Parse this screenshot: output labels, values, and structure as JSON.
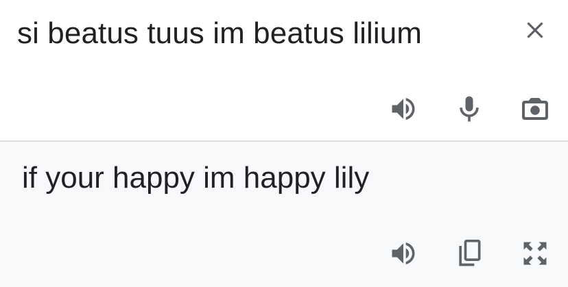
{
  "source": {
    "text": "si beatus tuus im beatus lilium",
    "icons": {
      "close": "close-icon",
      "speak": "volume-icon",
      "voice_input": "microphone-icon",
      "camera": "camera-icon"
    }
  },
  "translation": {
    "text": "if your happy im happy lily",
    "icons": {
      "speak": "volume-icon",
      "copy": "copy-icon",
      "fullscreen": "fullscreen-icon"
    }
  },
  "colors": {
    "text": "#202124",
    "icon": "#5f6368",
    "source_background": "#ffffff",
    "translation_background": "#f8f9fa",
    "divider": "#dadce0"
  }
}
